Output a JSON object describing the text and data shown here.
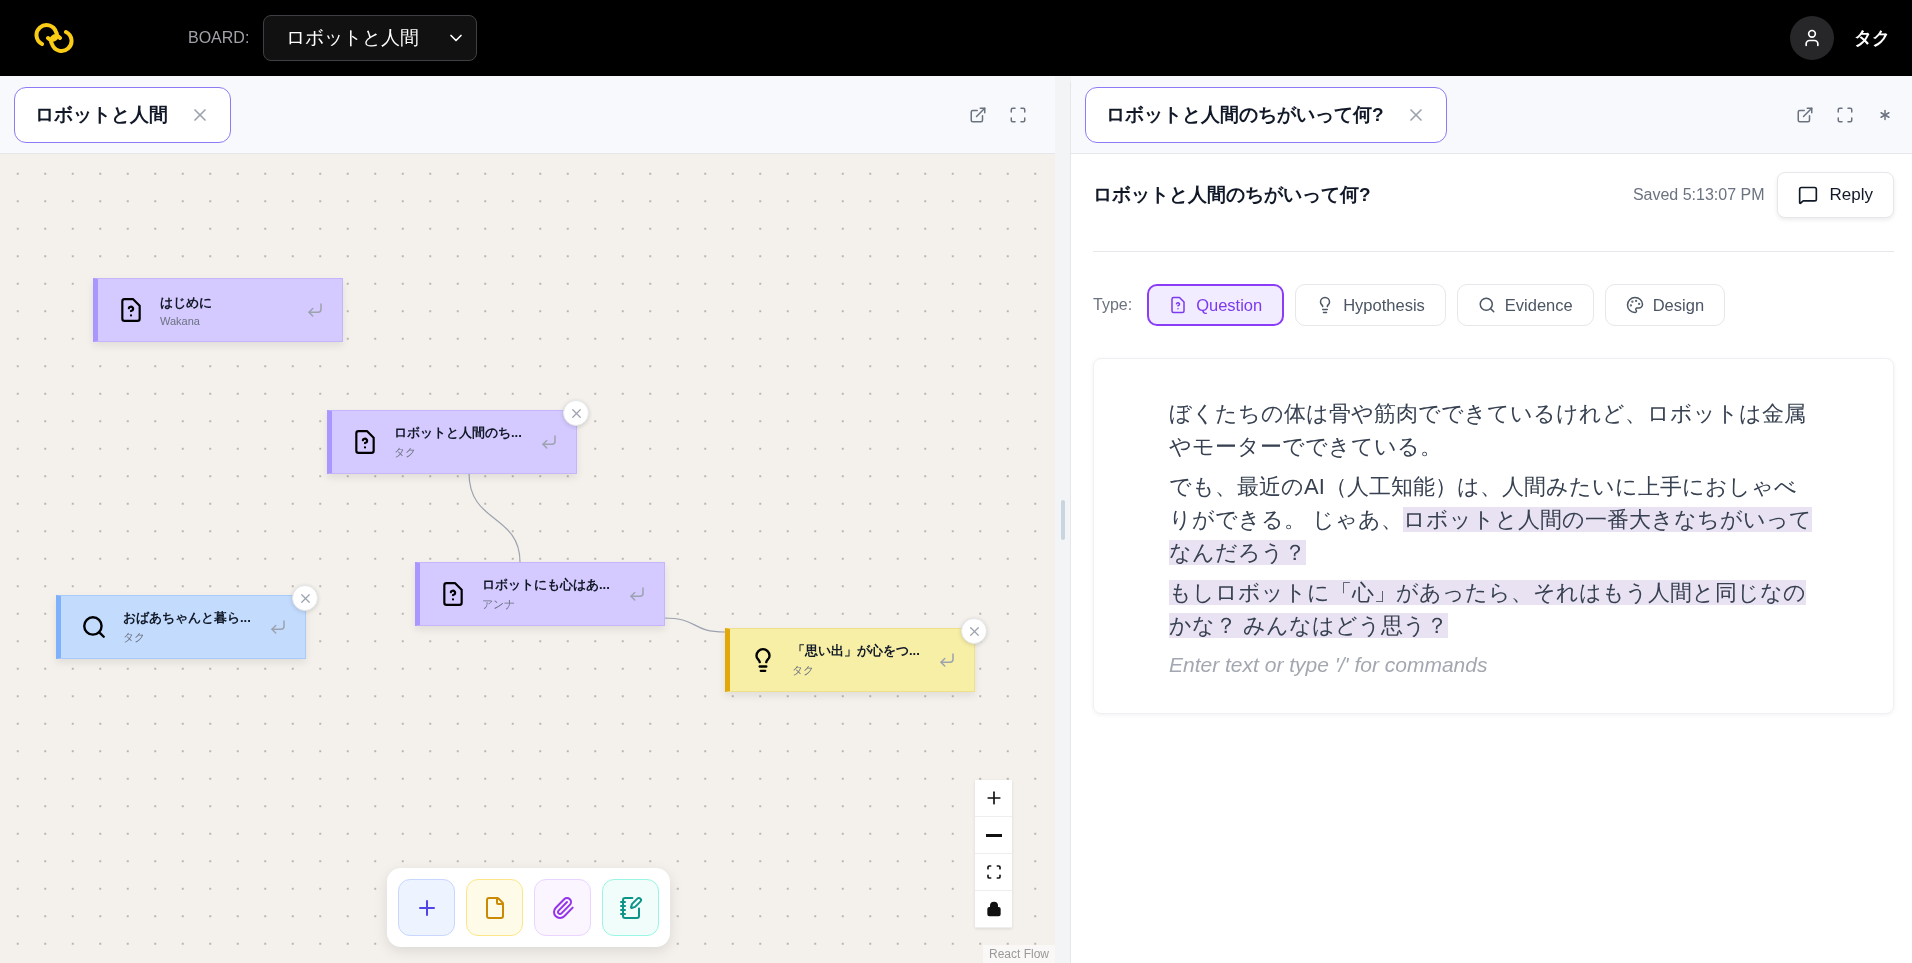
{
  "header": {
    "board_label": "BOARD:",
    "board": "ロボットと人間",
    "user": "タク"
  },
  "left_panel": {
    "tab": {
      "label": "ロボットと人間"
    }
  },
  "canvas": {
    "nodes": [
      {
        "kind": "question",
        "title": "はじめに",
        "author": "Wakana",
        "deletable": false
      },
      {
        "kind": "question",
        "title": "ロボットと人間のち...",
        "author": "タク",
        "deletable": true
      },
      {
        "kind": "question",
        "title": "ロボットにも心はあ...",
        "author": "アンナ",
        "deletable": false
      },
      {
        "kind": "evidence",
        "title": "おばあちゃんと暮ら...",
        "author": "タク",
        "deletable": true
      },
      {
        "kind": "hypothesis",
        "title": "「思い出」が心をつ...",
        "author": "タク",
        "deletable": true
      }
    ],
    "tools": [
      {
        "kind": "add"
      },
      {
        "kind": "file"
      },
      {
        "kind": "attach"
      },
      {
        "kind": "notebook"
      }
    ],
    "attribution": "React Flow"
  },
  "right_panel": {
    "tab": {
      "label": "ロボットと人間のちがいって何?"
    },
    "title": "ロボットと人間のちがいって何?",
    "saved": "Saved 5:13:07 PM",
    "reply": "Reply",
    "type_label": "Type:",
    "types": [
      {
        "kind": "question",
        "label": "Question",
        "selected": true
      },
      {
        "kind": "hypothesis",
        "label": "Hypothesis",
        "selected": false
      },
      {
        "kind": "evidence",
        "label": "Evidence",
        "selected": false
      },
      {
        "kind": "design",
        "label": "Design",
        "selected": false
      }
    ],
    "paragraphs": [
      [
        {
          "text": "ぼくたちの体は骨や筋肉でできているけれど、ロボットは金属やモーターでできている。",
          "highlighted": false
        }
      ],
      [
        {
          "text": "でも、最近のAI（人工知能）は、人間みたいに上手におしゃべりができる。 じゃあ、",
          "highlighted": false
        },
        {
          "text": "ロボットと人間の一番大きなちがいってなんだろう？",
          "highlighted": true
        }
      ],
      [
        {
          "text": "もしロボットに「心」があったら、それはもう人間と同じなのかな？ みんなはどう思う？",
          "highlighted": true
        }
      ]
    ],
    "placeholder": "Enter text or type '/' for commands"
  }
}
